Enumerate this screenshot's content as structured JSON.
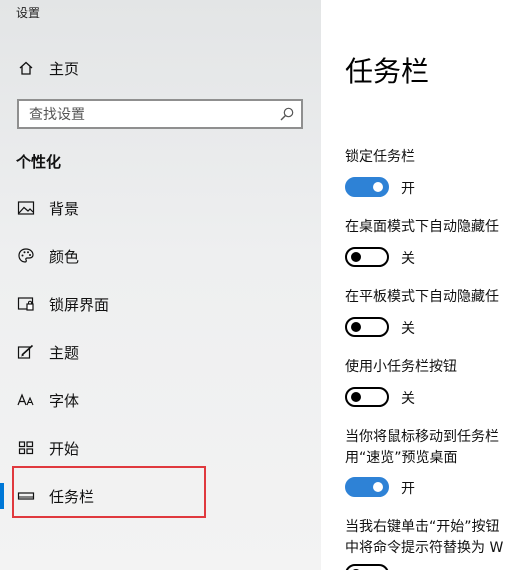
{
  "app": {
    "title": "设置"
  },
  "sidebar": {
    "home_label": "主页",
    "search": {
      "placeholder": "查找设置"
    },
    "section": "个性化",
    "items": [
      {
        "label": "背景",
        "icon": "image-icon"
      },
      {
        "label": "颜色",
        "icon": "palette-icon"
      },
      {
        "label": "锁屏界面",
        "icon": "lock-screen-icon"
      },
      {
        "label": "主题",
        "icon": "theme-brush-icon"
      },
      {
        "label": "字体",
        "icon": "font-icon"
      },
      {
        "label": "开始",
        "icon": "start-grid-icon"
      },
      {
        "label": "任务栏",
        "icon": "taskbar-icon",
        "active": true
      }
    ]
  },
  "colors": {
    "accent": "#0078d7",
    "toggle_on": "#2e82d6",
    "highlight": "#e0393e"
  },
  "main": {
    "title": "任务栏",
    "settings": [
      {
        "label": "锁定任务栏",
        "state": "on",
        "state_label": "开"
      },
      {
        "label": "在桌面模式下自动隐藏任",
        "state": "off",
        "state_label": "关"
      },
      {
        "label": "在平板模式下自动隐藏任",
        "state": "off",
        "state_label": "关"
      },
      {
        "label": "使用小任务栏按钮",
        "state": "off",
        "state_label": "关"
      },
      {
        "label_line1": "当你将鼠标移动到任务栏",
        "label_line2": "用“速览”预览桌面",
        "state": "on",
        "state_label": "开"
      },
      {
        "label_line1": "当我右键单击“开始”按钮",
        "label_line2": "中将命令提示符替换为 W"
      }
    ]
  }
}
